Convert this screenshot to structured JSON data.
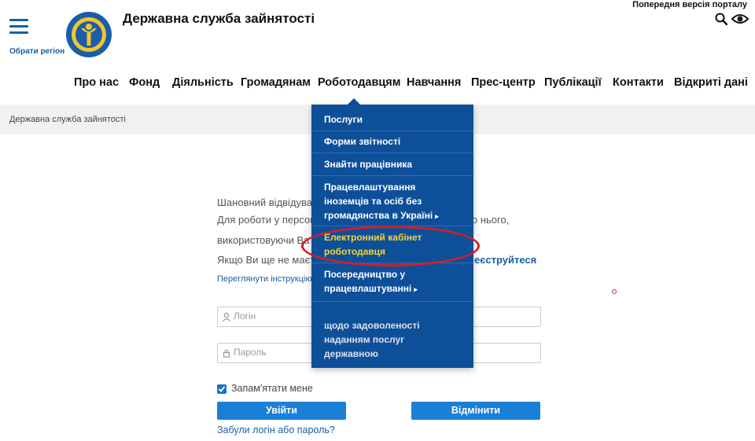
{
  "header": {
    "site_title": "Державна служба зайнятості",
    "region_link": "Обрати регіон",
    "prev_version": "Попередня версія порталу",
    "logo_text": "служба зайнятості"
  },
  "nav": {
    "items": [
      {
        "label": "Про нас"
      },
      {
        "label": "Фонд"
      },
      {
        "label": "Діяльність"
      },
      {
        "label": "Громадянам"
      },
      {
        "label": "Роботодавцям"
      },
      {
        "label": "Навчання"
      },
      {
        "label": "Прес-центр"
      },
      {
        "label": "Публікації"
      },
      {
        "label": "Контакти"
      },
      {
        "label": "Відкриті дані"
      }
    ]
  },
  "breadcrumb": "Державна служба зайнятості",
  "dropdown": {
    "items": [
      {
        "label": "Послуги"
      },
      {
        "label": "Форми звітності"
      },
      {
        "label": "Знайти працівника"
      },
      {
        "label": "Працевлаштування іноземців та осіб без громадянства в Україні"
      },
      {
        "label": "Електронний кабінет роботодавця"
      },
      {
        "label": "Посередництво у працевлаштуванні"
      },
      {
        "label": "щодо задоволеності наданням послуг державною"
      }
    ]
  },
  "login": {
    "line1": "Шановний відвідувач",
    "line2_start": "Для роботи у персон",
    "line2_end": "о нього,",
    "line3": "використовуючи Ва",
    "line4": "Якщо Ви ще не маєте",
    "register_link": "еєструйтеся",
    "instructions_link": "Переглянути інструкцію",
    "login_placeholder": "Логін",
    "password_placeholder": "Пароль",
    "remember_me": "Запам'ятати мене",
    "submit_button": "Увійти",
    "cancel_button": "Відмінити",
    "forgot_link": "Забули логін або пароль?"
  },
  "colors": {
    "brand_blue": "#1a5ea8",
    "dropdown_bg": "#0e4f9a",
    "button_blue": "#1a7fd6",
    "active_yellow": "#f7d23f",
    "highlight_red": "#d21f26"
  }
}
